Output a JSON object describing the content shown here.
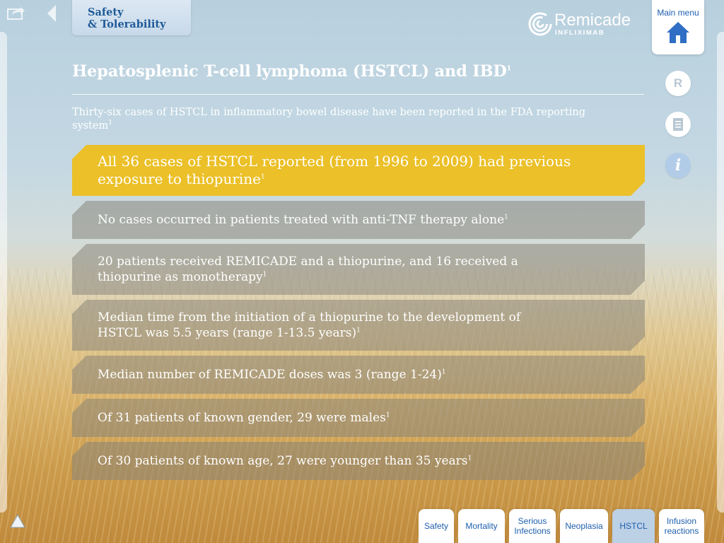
{
  "header": {
    "section_label": "Safety\n& Tolerability",
    "logo_name": "Remicade",
    "logo_sub": "INFLIXIMAB",
    "main_menu_label": "Main menu"
  },
  "side_buttons": {
    "r_label": "R",
    "info_label": "i"
  },
  "content": {
    "title": "Hepatosplenic T-cell lymphoma (HSTCL) and IBD",
    "title_ref": "1",
    "subtitle": "Thirty-six cases of HSTCL in inflammatory bowel disease have been reported in the FDA reporting system",
    "subtitle_ref": "1",
    "items": [
      {
        "text": "All 36 cases of HSTCL reported (from 1996 to 2009) had previous exposure to thiopurine",
        "ref": "1"
      },
      {
        "text": "No cases occurred in patients treated with anti-TNF therapy alone",
        "ref": "1"
      },
      {
        "text": "20 patients received REMICADE and a thiopurine, and 16 received a thiopurine as monotherapy",
        "ref": "1"
      },
      {
        "text": "Median time from the initiation of a thiopurine to the development of HSTCL was 5.5 years (range 1-13.5 years)",
        "ref": "1"
      },
      {
        "text": "Median number of REMICADE doses was 3 (range 1-24)",
        "ref": "1"
      },
      {
        "text": "Of 31 patients of known gender, 29 were males",
        "ref": "1"
      },
      {
        "text": "Of 30 patients of known age, 27 were younger than 35 years",
        "ref": "1"
      }
    ]
  },
  "tabs": [
    {
      "label": "Safety"
    },
    {
      "label": "Mortality"
    },
    {
      "label": "Serious\nInfections"
    },
    {
      "label": "Neoplasia"
    },
    {
      "label": "HSTCL",
      "active": true
    },
    {
      "label": "Infusion\nreactions"
    }
  ],
  "colors": {
    "accent_yellow": "#ebc028",
    "brand_blue": "#1e5fae",
    "active_tab": "#bcd0e6"
  },
  "icons": [
    "share-icon",
    "back-arrow-icon",
    "home-icon",
    "document-icon",
    "info-icon",
    "triangle-up-icon",
    "remicade-logo-icon"
  ]
}
